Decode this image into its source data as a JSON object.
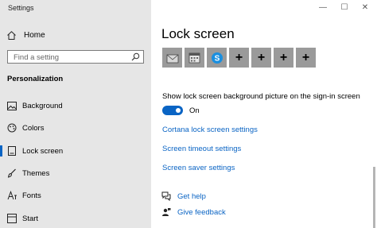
{
  "window": {
    "title": "Settings",
    "minimize_glyph": "—",
    "maximize_glyph": "☐",
    "close_glyph": "✕"
  },
  "sidebar": {
    "home_label": "Home",
    "search_placeholder": "Find a setting",
    "section_title": "Personalization",
    "items": [
      {
        "label": "Background",
        "icon": "image-icon"
      },
      {
        "label": "Colors",
        "icon": "palette-icon"
      },
      {
        "label": "Lock screen",
        "icon": "lock-screen-icon",
        "active": true
      },
      {
        "label": "Themes",
        "icon": "brush-icon"
      },
      {
        "label": "Fonts",
        "icon": "font-icon"
      },
      {
        "label": "Start",
        "icon": "start-icon"
      }
    ]
  },
  "main": {
    "title": "Lock screen",
    "quick_status_apps": [
      {
        "icon": "mail-icon"
      },
      {
        "icon": "calendar-icon"
      },
      {
        "icon": "skype-icon"
      },
      {
        "icon": "add-icon",
        "label": "+"
      },
      {
        "icon": "add-icon",
        "label": "+"
      },
      {
        "icon": "add-icon",
        "label": "+"
      },
      {
        "icon": "add-icon",
        "label": "+"
      }
    ],
    "signin_background_label": "Show lock screen background picture on the sign-in screen",
    "signin_background_state": "On",
    "links": {
      "cortana": "Cortana lock screen settings",
      "timeout": "Screen timeout settings",
      "saver": "Screen saver settings"
    },
    "help": {
      "get_help": "Get help",
      "give_feedback": "Give feedback"
    }
  },
  "colors": {
    "accent": "#0a64c4",
    "sidebar_bg": "#e6e6e6",
    "tile_bg": "#9a9a9a"
  }
}
